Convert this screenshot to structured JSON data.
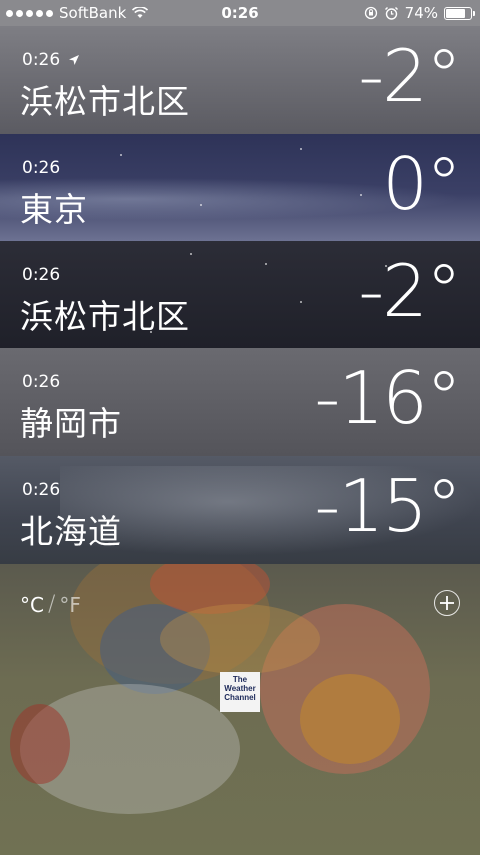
{
  "status_bar": {
    "carrier": "SoftBank",
    "time": "0:26",
    "battery": "74%",
    "battery_level": 0.74
  },
  "locations": [
    {
      "time": "0:26",
      "city": "浜松市北区",
      "temp": "-2°",
      "current_location": true
    },
    {
      "time": "0:26",
      "city": "東京",
      "temp": "0°",
      "current_location": false
    },
    {
      "time": "0:26",
      "city": "浜松市北区",
      "temp": "-2°",
      "current_location": false
    },
    {
      "time": "0:26",
      "city": "静岡市",
      "temp": "-16°",
      "current_location": false
    },
    {
      "time": "0:26",
      "city": "北海道",
      "temp": "-15°",
      "current_location": false
    }
  ],
  "footer": {
    "celsius_label": "°C",
    "separator": "/",
    "fahrenheit_label": "°F",
    "logo_text": "The Weather Channel"
  },
  "icons": [
    "signal-dots-icon",
    "wifi-icon",
    "rotation-lock-icon",
    "alarm-icon",
    "battery-icon",
    "location-arrow-icon",
    "add-icon"
  ]
}
